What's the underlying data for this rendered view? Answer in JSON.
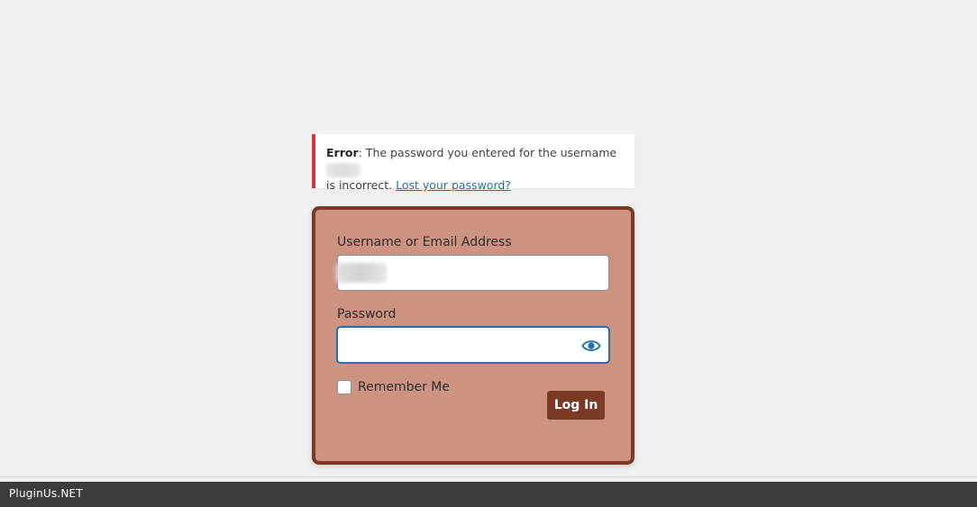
{
  "colors": {
    "page_background": "#f0f0f1",
    "error_accent": "#d63638",
    "form_background": "#cd9381",
    "form_border": "#7b3a24",
    "button_background": "#7b3a24",
    "link_color": "#2271b1",
    "footer_background": "#3c3c3c"
  },
  "notice": {
    "label": "Error",
    "message_before": ": The password you entered for the username",
    "message_after": "is incorrect.",
    "link_text": "Lost your password?"
  },
  "form": {
    "username_label": "Username or Email Address",
    "username_value": "",
    "password_label": "Password",
    "password_value": "",
    "show_password_icon": "eye-icon",
    "remember_label": "Remember Me",
    "remember_checked": false,
    "submit_label": "Log In"
  },
  "footer": {
    "brand": "PluginUs.NET"
  }
}
